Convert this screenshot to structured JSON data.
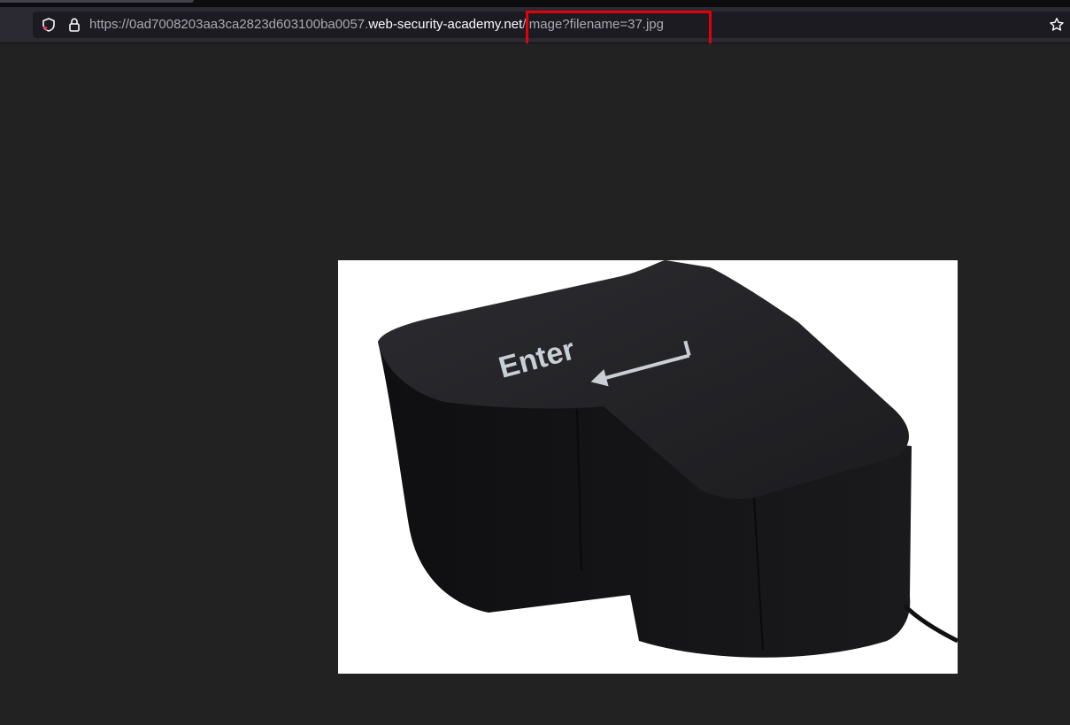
{
  "browser": {
    "url": {
      "prefix": "https://0ad7008203aa3ca2823d603100ba0057.",
      "domain": "web-security-academy.net",
      "path": "/image?filename=37.jpg"
    },
    "icons": {
      "tracking_protection": "shield-icon",
      "security": "lock-icon",
      "bookmark": "star-icon"
    },
    "annotation_color": "#e3000b"
  },
  "content": {
    "image": {
      "alt_label": "Enter",
      "subject": "enter-key-cushion",
      "background": "#ffffff"
    }
  }
}
